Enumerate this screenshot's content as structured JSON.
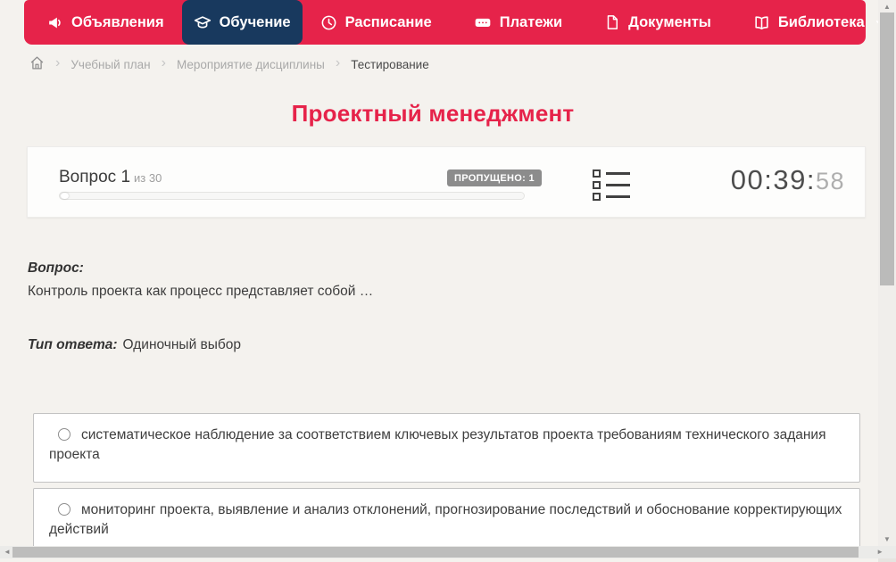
{
  "navbar": {
    "items": [
      {
        "label": "Объявления",
        "icon": "megaphone-icon",
        "active": false
      },
      {
        "label": "Обучение",
        "icon": "graduation-cap-icon",
        "active": true
      },
      {
        "label": "Расписание",
        "icon": "clock-icon",
        "active": false
      },
      {
        "label": "Платежи",
        "icon": "banknote-icon",
        "active": false
      },
      {
        "label": "Документы",
        "icon": "document-icon",
        "active": false
      },
      {
        "label": "Библиотека",
        "icon": "book-icon",
        "active": false,
        "has_dropdown": true
      }
    ]
  },
  "breadcrumb": {
    "items": [
      "Учебный план",
      "Мероприятие дисциплины",
      "Тестирование"
    ]
  },
  "page": {
    "title": "Проектный менеджмент"
  },
  "quiz": {
    "question_label": "Вопрос 1",
    "question_total": "из 30",
    "skipped_badge": "ПРОПУЩЕНО: 1",
    "timer_main": "00:39:",
    "timer_seconds": "58",
    "progress_percent": 0,
    "question_heading": "Вопрос:",
    "question_text": "Контроль проекта как процесс представляет собой …",
    "answer_type_label": "Тип ответа:",
    "answer_type_value": "Одиночный выбор",
    "options": [
      {
        "text": "систематическое наблюдение за соответствием ключевых результатов проекта требованиям технического задания проекта",
        "selected": false
      },
      {
        "text": "мониторинг проекта, выявление и анализ отклонений, прогнозирование последствий и обоснование корректирующих действий",
        "selected": false
      }
    ]
  },
  "colors": {
    "navbar_bg": "#e6234a",
    "active_tab_bg": "#18395e",
    "page_bg": "#f4f2ee",
    "title_accent": "#e6234a",
    "badge_bg": "#8c8c8c"
  }
}
